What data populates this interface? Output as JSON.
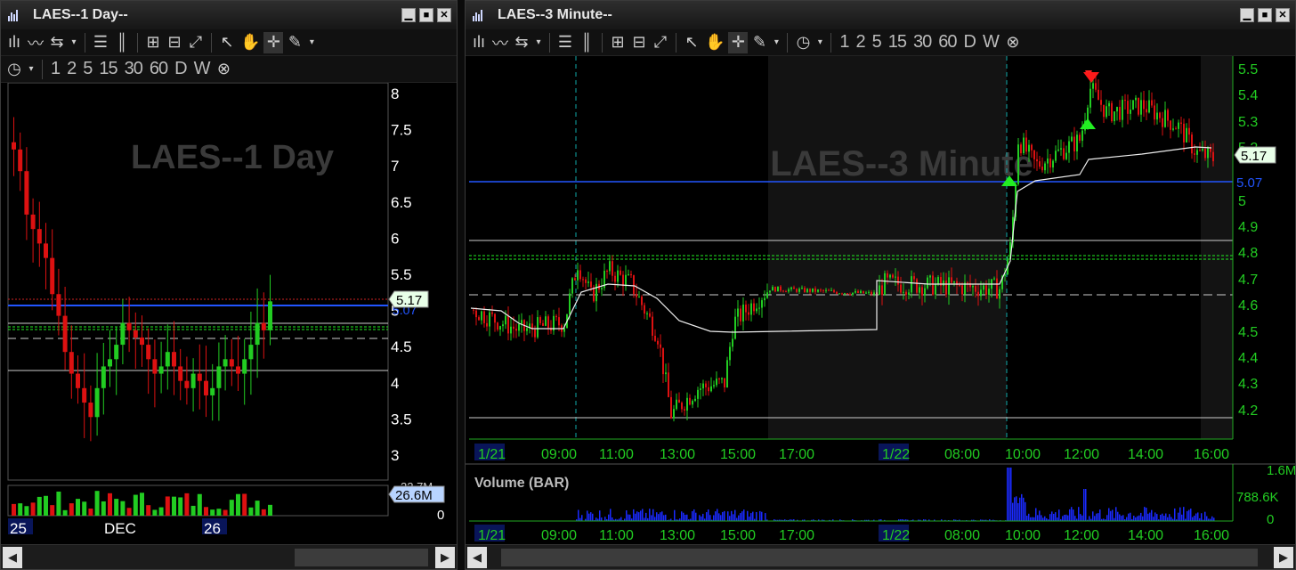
{
  "left_window": {
    "title": "LAES--1 Day--",
    "watermark": "LAES--1 Day",
    "periods": [
      "1",
      "2",
      "5",
      "15",
      "30",
      "60",
      "D",
      "W"
    ],
    "price_axis": [
      "8",
      "7.5",
      "7",
      "6.5",
      "6",
      "5.5",
      "5",
      "4.5",
      "4",
      "3.5",
      "3"
    ],
    "last_price": "5.17",
    "last_price_behind": "5.07",
    "volume_top": "22.7M",
    "volume_badge": "26.6M",
    "volume_zero": "0",
    "date_labels": [
      "25",
      "DEC",
      "26"
    ]
  },
  "right_window": {
    "title": "LAES--3 Minute--",
    "watermark": "LAES--3 Minute",
    "periods": [
      "1",
      "2",
      "5",
      "15",
      "30",
      "60",
      "D",
      "W"
    ],
    "price_axis": [
      "5.5",
      "5.4",
      "5.3",
      "5.2",
      "5",
      "4.9",
      "4.8",
      "4.7",
      "4.6",
      "4.5",
      "4.4",
      "4.3",
      "4.2"
    ],
    "last_price": "5.17",
    "blue_line_price": "5.07",
    "time_labels": [
      "1/21",
      "09:00",
      "11:00",
      "13:00",
      "15:00",
      "17:00",
      "1/22",
      "08:00",
      "10:00",
      "12:00",
      "14:00",
      "16:00"
    ],
    "volume_title": "Volume (BAR)",
    "volume_axis": [
      "1.6M",
      "788.6K",
      "0"
    ]
  },
  "colors": {
    "up": "#22cc22",
    "down": "#dd1111",
    "blue_line": "#2255ff",
    "dashed_green": "#22ee22",
    "axis_green": "#22aa22",
    "volume_blue": "#1a2aff"
  },
  "icons": {
    "window": "bar-chart-icon",
    "scroll_left": "arrow-left-icon",
    "scroll_right": "arrow-right-icon",
    "cursor": "arrow-cursor-icon",
    "pan": "hand-icon",
    "crosshair": "crosshair-icon",
    "draw": "pencil-icon",
    "clock": "clock-icon",
    "close": "circle-x-icon"
  }
}
